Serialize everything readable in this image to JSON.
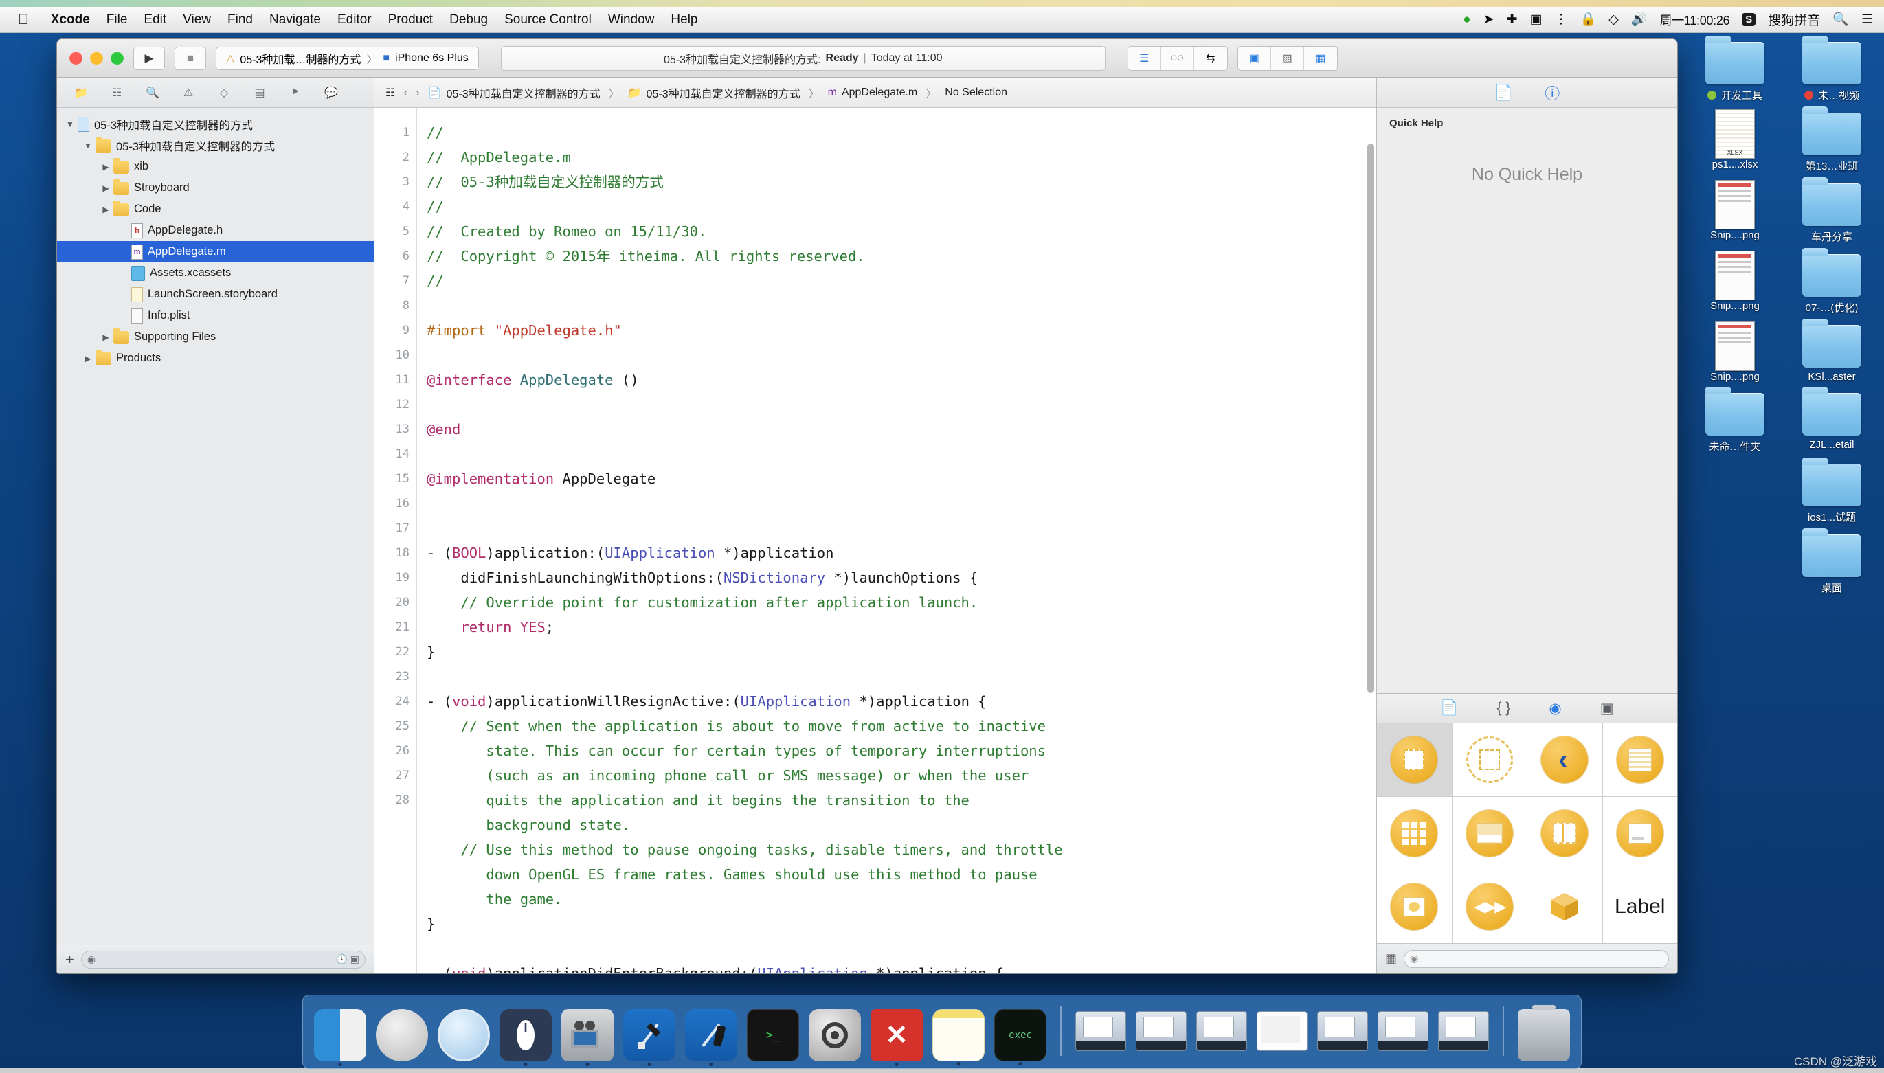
{
  "menubar": {
    "apple_icon": "apple-logo",
    "items": [
      "Xcode",
      "File",
      "Edit",
      "View",
      "Find",
      "Navigate",
      "Editor",
      "Product",
      "Debug",
      "Source Control",
      "Window",
      "Help"
    ],
    "status_icons": [
      "screen-share-green-icon",
      "location-arrow-icon",
      "bluetooth-icon",
      "screen-record-icon",
      "sound-wave-icon",
      "lock-icon",
      "vpn-shield-icon",
      "volume-icon"
    ],
    "clock": "周一11:00:26",
    "input_method_badge": "S",
    "input_method_label": "搜狗拼音",
    "search_icon": "search-icon",
    "notification_icon": "notification-center-icon"
  },
  "xcode": {
    "toolbar": {
      "run_button": "run-play-icon",
      "stop_button": "stop-square-icon",
      "scheme_name": "05-3种加载…制器的方式",
      "scheme_separator": "〉",
      "destination": "iPhone 6s Plus",
      "activity_project": "05-3种加载自定义控制器的方式:",
      "activity_status": "Ready",
      "activity_pipe": "|",
      "activity_time": "Today at 11:00",
      "editor_modes": [
        "standard-editor-icon",
        "assistant-editor-icon",
        "version-editor-icon"
      ],
      "view_toggles": [
        "navigator-toggle-icon",
        "debug-area-toggle-icon",
        "utilities-toggle-icon"
      ]
    },
    "navigator": {
      "tabs": [
        "project-navigator-icon",
        "symbol-navigator-icon",
        "find-navigator-icon",
        "issue-navigator-icon",
        "test-navigator-icon",
        "debug-navigator-icon",
        "breakpoint-navigator-icon",
        "report-navigator-icon"
      ],
      "active_tab_index": 0,
      "tree": [
        {
          "label": "05-3种加载自定义控制器的方式",
          "icon": "project-icon",
          "indent": 0,
          "twisty": "▼",
          "selected": false
        },
        {
          "label": "05-3种加载自定义控制器的方式",
          "icon": "folder-icon",
          "indent": 1,
          "twisty": "▼",
          "selected": false
        },
        {
          "label": "xib",
          "icon": "folder-icon",
          "indent": 2,
          "twisty": "▶",
          "selected": false
        },
        {
          "label": "Stroyboard",
          "icon": "folder-icon",
          "indent": 2,
          "twisty": "▶",
          "selected": false
        },
        {
          "label": "Code",
          "icon": "folder-icon",
          "indent": 2,
          "twisty": "▶",
          "selected": false
        },
        {
          "label": "AppDelegate.h",
          "icon": "header-file-icon",
          "indent": 3,
          "twisty": "",
          "selected": false
        },
        {
          "label": "AppDelegate.m",
          "icon": "implementation-file-icon",
          "indent": 3,
          "twisty": "",
          "selected": true
        },
        {
          "label": "Assets.xcassets",
          "icon": "assets-catalog-icon",
          "indent": 3,
          "twisty": "",
          "selected": false
        },
        {
          "label": "LaunchScreen.storyboard",
          "icon": "storyboard-icon",
          "indent": 3,
          "twisty": "",
          "selected": false
        },
        {
          "label": "Info.plist",
          "icon": "plist-icon",
          "indent": 3,
          "twisty": "",
          "selected": false
        },
        {
          "label": "Supporting Files",
          "icon": "folder-icon",
          "indent": 2,
          "twisty": "▶",
          "selected": false
        },
        {
          "label": "Products",
          "icon": "folder-icon",
          "indent": 1,
          "twisty": "▶",
          "selected": false
        }
      ],
      "add_button": "+",
      "filter_placeholder": "",
      "filter_icons": [
        "recent-clock-icon",
        "source-control-icon"
      ]
    },
    "jumpbar": {
      "related_items_icon": "related-items-icon",
      "back_icon": "‹",
      "forward_icon": "›",
      "crumbs": [
        "05-3种加载自定义控制器的方式",
        "05-3种加载自定义控制器的方式",
        "AppDelegate.m",
        "No Selection"
      ],
      "crumb_icons": [
        "project-icon",
        "folder-icon",
        "implementation-file-icon",
        ""
      ],
      "separator": "〉"
    },
    "editor": {
      "filename": "AppDelegate.m",
      "lines": [
        {
          "n": "1",
          "tokens": [
            {
              "t": "//",
              "c": "c-cmt"
            }
          ]
        },
        {
          "n": "2",
          "tokens": [
            {
              "t": "//  AppDelegate.m",
              "c": "c-cmt"
            }
          ]
        },
        {
          "n": "3",
          "tokens": [
            {
              "t": "//  05-3种加载自定义控制器的方式",
              "c": "c-cmt"
            }
          ]
        },
        {
          "n": "4",
          "tokens": [
            {
              "t": "//",
              "c": "c-cmt"
            }
          ]
        },
        {
          "n": "5",
          "tokens": [
            {
              "t": "//  Created by Romeo on 15/11/30.",
              "c": "c-cmt"
            }
          ]
        },
        {
          "n": "6",
          "tokens": [
            {
              "t": "//  Copyright © 2015年 itheima. All rights reserved.",
              "c": "c-cmt"
            }
          ]
        },
        {
          "n": "7",
          "tokens": [
            {
              "t": "//",
              "c": "c-cmt"
            }
          ]
        },
        {
          "n": "8",
          "tokens": []
        },
        {
          "n": "9",
          "tokens": [
            {
              "t": "#import ",
              "c": "c-pre"
            },
            {
              "t": "\"AppDelegate.h\"",
              "c": "c-str"
            }
          ]
        },
        {
          "n": "10",
          "tokens": []
        },
        {
          "n": "11",
          "tokens": [
            {
              "t": "@interface ",
              "c": "c-kw"
            },
            {
              "t": "AppDelegate",
              "c": "c-cls"
            },
            {
              "t": " ()",
              "c": ""
            }
          ]
        },
        {
          "n": "12",
          "tokens": []
        },
        {
          "n": "13",
          "tokens": [
            {
              "t": "@end",
              "c": "c-kw"
            }
          ]
        },
        {
          "n": "14",
          "tokens": []
        },
        {
          "n": "15",
          "tokens": [
            {
              "t": "@implementation ",
              "c": "c-kw"
            },
            {
              "t": "AppDelegate",
              "c": ""
            }
          ]
        },
        {
          "n": "16",
          "tokens": []
        },
        {
          "n": "17",
          "tokens": []
        },
        {
          "n": "18",
          "tokens": [
            {
              "t": "- (",
              "c": ""
            },
            {
              "t": "BOOL",
              "c": "c-kw"
            },
            {
              "t": ")application:(",
              "c": ""
            },
            {
              "t": "UIApplication",
              "c": "c-typ"
            },
            {
              "t": " *)application",
              "c": ""
            }
          ]
        },
        {
          "n": "",
          "tokens": [
            {
              "t": "    didFinishLaunchingWithOptions:(",
              "c": ""
            },
            {
              "t": "NSDictionary",
              "c": "c-typ"
            },
            {
              "t": " *)launchOptions {",
              "c": ""
            }
          ]
        },
        {
          "n": "19",
          "tokens": [
            {
              "t": "    // Override point for customization after application launch.",
              "c": "c-cmt"
            }
          ]
        },
        {
          "n": "20",
          "tokens": [
            {
              "t": "    ",
              "c": ""
            },
            {
              "t": "return YES",
              "c": "c-kw"
            },
            {
              "t": ";",
              "c": ""
            }
          ]
        },
        {
          "n": "21",
          "tokens": [
            {
              "t": "}",
              "c": ""
            }
          ]
        },
        {
          "n": "22",
          "tokens": []
        },
        {
          "n": "23",
          "tokens": [
            {
              "t": "- (",
              "c": ""
            },
            {
              "t": "void",
              "c": "c-kw"
            },
            {
              "t": ")applicationWillResignActive:(",
              "c": ""
            },
            {
              "t": "UIApplication",
              "c": "c-typ"
            },
            {
              "t": " *)application {",
              "c": ""
            }
          ]
        },
        {
          "n": "24",
          "tokens": [
            {
              "t": "    // Sent when the application is about to move from active to inactive",
              "c": "c-cmt"
            }
          ]
        },
        {
          "n": "",
          "tokens": [
            {
              "t": "       state. This can occur for certain types of temporary interruptions",
              "c": "c-cmt"
            }
          ]
        },
        {
          "n": "",
          "tokens": [
            {
              "t": "       (such as an incoming phone call or SMS message) or when the user",
              "c": "c-cmt"
            }
          ]
        },
        {
          "n": "",
          "tokens": [
            {
              "t": "       quits the application and it begins the transition to the",
              "c": "c-cmt"
            }
          ]
        },
        {
          "n": "",
          "tokens": [
            {
              "t": "       background state.",
              "c": "c-cmt"
            }
          ]
        },
        {
          "n": "25",
          "tokens": [
            {
              "t": "    // Use this method to pause ongoing tasks, disable timers, and throttle",
              "c": "c-cmt"
            }
          ]
        },
        {
          "n": "",
          "tokens": [
            {
              "t": "       down OpenGL ES frame rates. Games should use this method to pause",
              "c": "c-cmt"
            }
          ]
        },
        {
          "n": "",
          "tokens": [
            {
              "t": "       the game.",
              "c": "c-cmt"
            }
          ]
        },
        {
          "n": "26",
          "tokens": [
            {
              "t": "}",
              "c": ""
            }
          ]
        },
        {
          "n": "27",
          "tokens": []
        },
        {
          "n": "28",
          "tokens": [
            {
              "t": "- (",
              "c": ""
            },
            {
              "t": "void",
              "c": "c-kw"
            },
            {
              "t": ")applicationDidEnterBackground:(",
              "c": ""
            },
            {
              "t": "UIApplication",
              "c": "c-typ"
            },
            {
              "t": " *)application {",
              "c": ""
            }
          ]
        }
      ]
    },
    "utilities": {
      "inspector_tabs": [
        "file-inspector-icon",
        "quick-help-inspector-icon"
      ],
      "active_inspector_index": 1,
      "quick_help_title": "Quick Help",
      "quick_help_empty": "No Quick Help",
      "library_tabs": [
        "file-template-library-icon",
        "code-snippet-library-icon",
        "object-library-icon",
        "media-library-icon"
      ],
      "active_library_index": 2,
      "objects": [
        {
          "name": "View Controller",
          "icon": "view-controller-icon",
          "selected": true
        },
        {
          "name": "Storyboard Reference",
          "icon": "storyboard-reference-icon",
          "selected": false
        },
        {
          "name": "Navigation Controller",
          "icon": "navigation-controller-icon",
          "selected": false
        },
        {
          "name": "Table View Controller",
          "icon": "table-view-controller-icon",
          "selected": false
        },
        {
          "name": "Collection View Controller",
          "icon": "collection-view-controller-icon",
          "selected": false
        },
        {
          "name": "Tab Bar Controller",
          "icon": "tab-bar-controller-icon",
          "selected": false
        },
        {
          "name": "Split View Controller",
          "icon": "split-view-controller-icon",
          "selected": false
        },
        {
          "name": "Page View Controller",
          "icon": "page-view-controller-icon",
          "selected": false
        },
        {
          "name": "Image View Controller",
          "icon": "image-view-controller-icon",
          "selected": false
        },
        {
          "name": "AVKit Player View Controller",
          "icon": "av-player-icon",
          "selected": false
        },
        {
          "name": "GLKit View Controller",
          "icon": "glkit-cube-icon",
          "selected": false
        },
        {
          "name": "Label",
          "icon": "label-icon",
          "selected": false,
          "text": "Label"
        }
      ],
      "library_filter_placeholder": "",
      "library_layout_icon": "grid-layout-icon"
    }
  },
  "desktop": {
    "icons": [
      {
        "label": "开发工具",
        "type": "folder",
        "tag": "green"
      },
      {
        "label": "未…视频",
        "type": "folder",
        "tag": "red"
      },
      {
        "label": "ps1....xlsx",
        "type": "xlsx",
        "tag": ""
      },
      {
        "label": "第13…业班",
        "type": "folder",
        "tag": ""
      },
      {
        "label": "Snip....png",
        "type": "png",
        "tag": ""
      },
      {
        "label": "车丹分享",
        "type": "folder",
        "tag": ""
      },
      {
        "label": "Snip....png",
        "type": "png",
        "tag": ""
      },
      {
        "label": "07-…(优化)",
        "type": "folder",
        "tag": ""
      },
      {
        "label": "Snip....png",
        "type": "png",
        "tag": ""
      },
      {
        "label": "KSl...aster",
        "type": "folder",
        "tag": ""
      },
      {
        "label": "未命…件夹",
        "type": "folder",
        "tag": ""
      },
      {
        "label": "ZJL...etail",
        "type": "folder",
        "tag": ""
      },
      {
        "label": "",
        "type": "none",
        "tag": ""
      },
      {
        "label": "ios1...试题",
        "type": "folder",
        "tag": ""
      },
      {
        "label": "",
        "type": "none",
        "tag": ""
      },
      {
        "label": "桌面",
        "type": "folder",
        "tag": ""
      }
    ],
    "xlsx_tag": "XLSX"
  },
  "dock": {
    "items": [
      {
        "name": "Finder",
        "icon": "finder-icon",
        "running": true
      },
      {
        "name": "Launchpad",
        "icon": "launchpad-icon",
        "running": false
      },
      {
        "name": "Safari",
        "icon": "safari-icon",
        "running": false
      },
      {
        "name": "Mouse Utility",
        "icon": "mouse-icon",
        "running": true
      },
      {
        "name": "QuickTime Player",
        "icon": "quicktime-icon",
        "running": true
      },
      {
        "name": "Xcode",
        "icon": "xcode-icon",
        "running": true
      },
      {
        "name": "Xcode Beta",
        "icon": "xcode-beta-icon",
        "running": true
      },
      {
        "name": "Terminal",
        "icon": "terminal-icon",
        "running": false
      },
      {
        "name": "System Preferences",
        "icon": "system-preferences-icon",
        "running": false
      },
      {
        "name": "XMind",
        "icon": "xmind-icon",
        "running": true
      },
      {
        "name": "Notes",
        "icon": "notes-icon",
        "running": true
      },
      {
        "name": "exec",
        "icon": "exec-terminal-icon",
        "running": true
      }
    ],
    "minimized": [
      {
        "name": "Minimized Window 1",
        "icon": "minimized-window-icon"
      },
      {
        "name": "Minimized Window 2",
        "icon": "minimized-window-icon"
      },
      {
        "name": "Minimized Window 3",
        "icon": "minimized-window-icon"
      },
      {
        "name": "Minimized Document",
        "icon": "minimized-document-icon"
      },
      {
        "name": "Minimized Window 5",
        "icon": "minimized-window-icon"
      },
      {
        "name": "Minimized Window 6",
        "icon": "minimized-window-icon"
      },
      {
        "name": "Minimized Window 7",
        "icon": "minimized-window-icon"
      }
    ],
    "trash": "Trash",
    "xmind_glyph": "✕",
    "exec_glyph": "exec",
    "terminal_glyph": "&gt;_"
  },
  "watermark": "CSDN @泛游戏"
}
